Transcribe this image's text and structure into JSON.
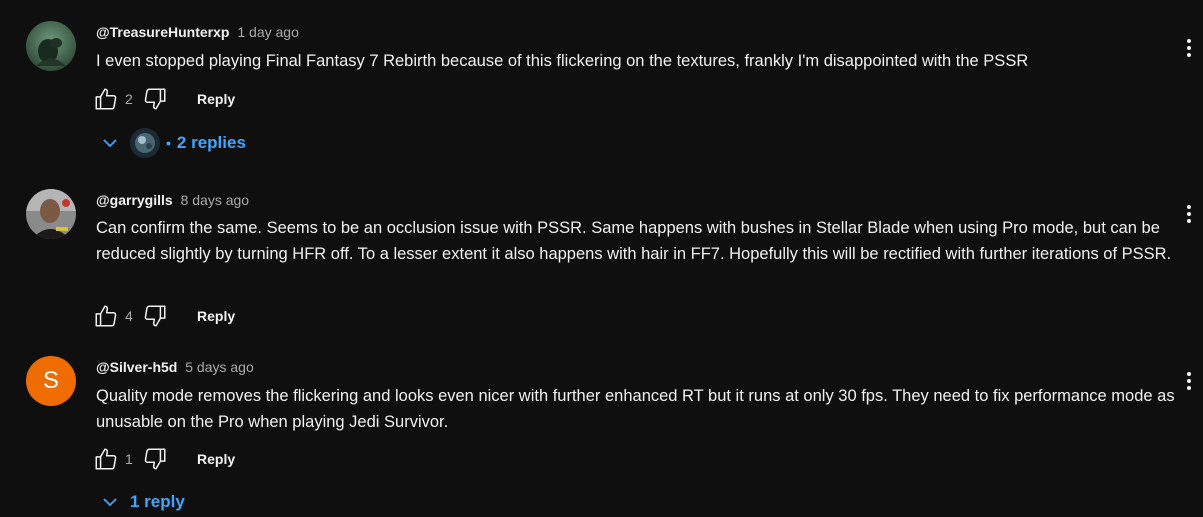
{
  "comments": [
    {
      "author": "@TreasureHunterxp",
      "time": "1 day ago",
      "text": "I even stopped playing Final Fantasy 7 Rebirth because of this flickering on the textures, frankly I'm disappointed with the PSSR",
      "likes": "2",
      "reply_label": "Reply",
      "replies_label": "2 replies",
      "replies_separator": "•"
    },
    {
      "author": "@garrygills",
      "time": "8 days ago",
      "text": "Can confirm the same. Seems to be an occlusion issue with PSSR. Same happens with bushes in Stellar Blade when using Pro mode, but can be reduced slightly by turning HFR off. To a lesser extent it also happens with hair in FF7. Hopefully this will be rectified with further iterations of PSSR.",
      "likes": "4",
      "reply_label": "Reply"
    },
    {
      "author": "@Silver-h5d",
      "time": "5 days ago",
      "avatar_letter": "S",
      "text": "Quality mode removes the flickering and looks even nicer with further enhanced RT but it runs at only 30 fps. They need to fix performance mode as unusable on the Pro when playing Jedi Survivor.",
      "likes": "1",
      "reply_label": "Reply",
      "replies_label": "1 reply"
    }
  ],
  "colors": {
    "background": "#0f0f0f",
    "text": "#f1f1f1",
    "muted": "#aaaaaa",
    "link": "#3ea6ff",
    "letter_avatar": "#ef6c00"
  },
  "icons": [
    "like-icon",
    "dislike-icon",
    "more-vert-icon",
    "chevron-down-icon"
  ]
}
